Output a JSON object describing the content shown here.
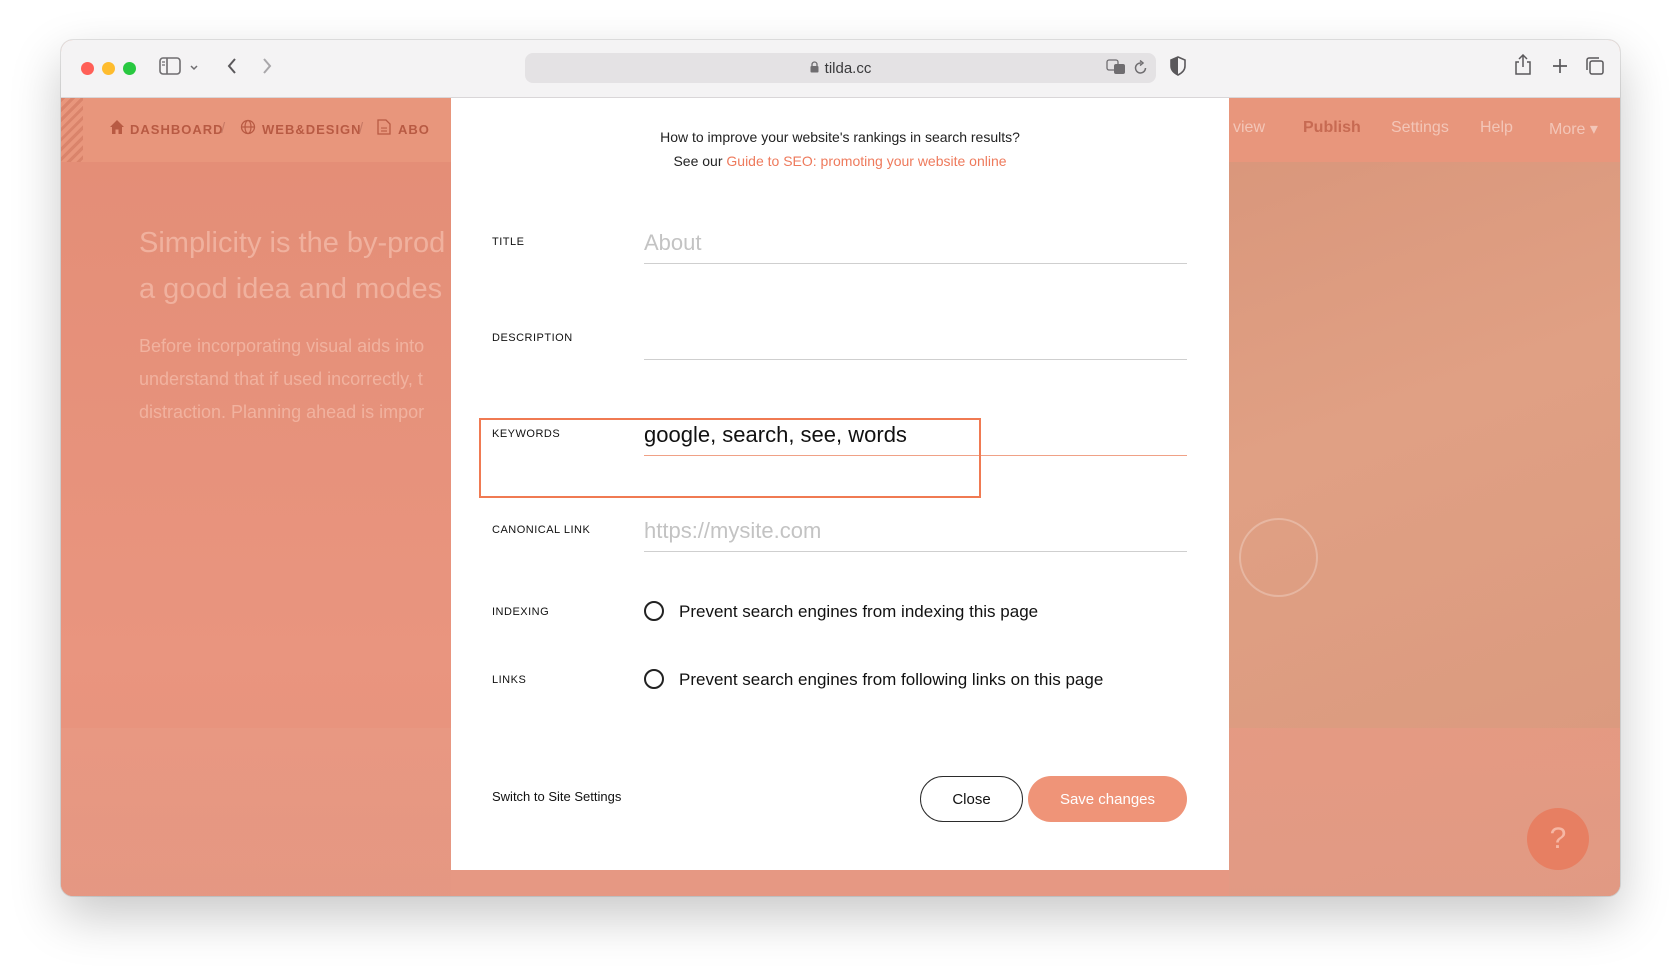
{
  "browser": {
    "url": "tilda.cc"
  },
  "nav": {
    "crumbs": [
      "DASHBOARD",
      "WEB&DESIGN",
      "ABO"
    ],
    "right_items": [
      "view",
      "Publish",
      "Settings",
      "Help",
      "More ▾"
    ]
  },
  "hero": {
    "title_line1": "Simplicity is the by-prod",
    "title_line2": "a good idea and modes",
    "text_line1": "Before incorporating visual aids into",
    "text_line2": "understand that if used incorrectly, t",
    "text_line3": "distraction. Planning ahead is impor"
  },
  "modal": {
    "hint_line1": "How to improve your website's rankings in search results?",
    "hint_prefix": "See our ",
    "hint_link": "Guide to SEO: promoting your website online",
    "fields": {
      "title": {
        "label": "TITLE",
        "value": "",
        "placeholder": "About"
      },
      "description": {
        "label": "DESCRIPTION",
        "value": "",
        "placeholder": ""
      },
      "keywords": {
        "label": "KEYWORDS",
        "value": "google, search, see, words",
        "placeholder": ""
      },
      "canonical": {
        "label": "CANONICAL LINK",
        "value": "",
        "placeholder": "https://mysite.com"
      }
    },
    "indexing": {
      "label": "INDEXING",
      "option": "Prevent search engines from indexing this page",
      "checked": false
    },
    "links": {
      "label": "LINKS",
      "option": "Prevent search engines from following links on this page",
      "checked": false
    },
    "switch_link": "Switch to Site Settings",
    "close_label": "Close",
    "save_label": "Save changes",
    "accent_color": "#ef9478"
  },
  "help_bubble": "?"
}
